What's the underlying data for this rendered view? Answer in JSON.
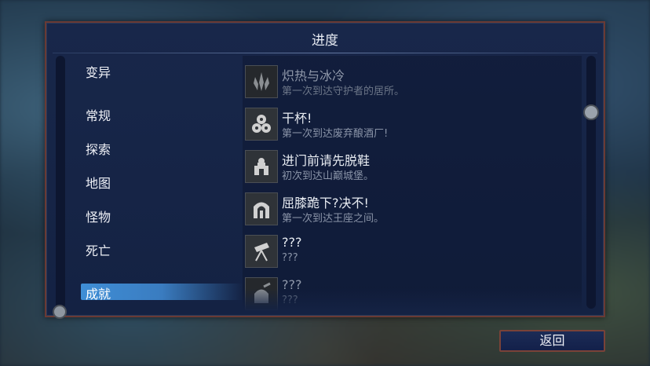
{
  "window": {
    "title": "进度"
  },
  "categories": {
    "items": [
      {
        "label": "变异"
      },
      {
        "label": "常规"
      },
      {
        "label": "探索"
      },
      {
        "label": "地图"
      },
      {
        "label": "怪物"
      },
      {
        "label": "死亡"
      }
    ],
    "selected": {
      "label": "成就"
    }
  },
  "achievements": [
    {
      "title": "炽热与冰冷",
      "desc": "第一次到达守护者的居所。",
      "icon": "flame-crystal-icon",
      "state": "faded"
    },
    {
      "title": "干杯!",
      "desc": "第一次到达废弃酿酒厂!",
      "icon": "barrels-icon",
      "state": "unlocked"
    },
    {
      "title": "进门前请先脱鞋",
      "desc": "初次到达山巅城堡。",
      "icon": "castle-icon",
      "state": "unlocked"
    },
    {
      "title": "屈膝跪下?决不!",
      "desc": "第一次到达王座之间。",
      "icon": "throne-gate-icon",
      "state": "unlocked"
    },
    {
      "title": "???",
      "desc": "???",
      "icon": "telescope-icon",
      "state": "locked"
    },
    {
      "title": "???",
      "desc": "???",
      "icon": "observatory-icon",
      "state": "locked"
    }
  ],
  "footer": {
    "back_label": "返回"
  }
}
